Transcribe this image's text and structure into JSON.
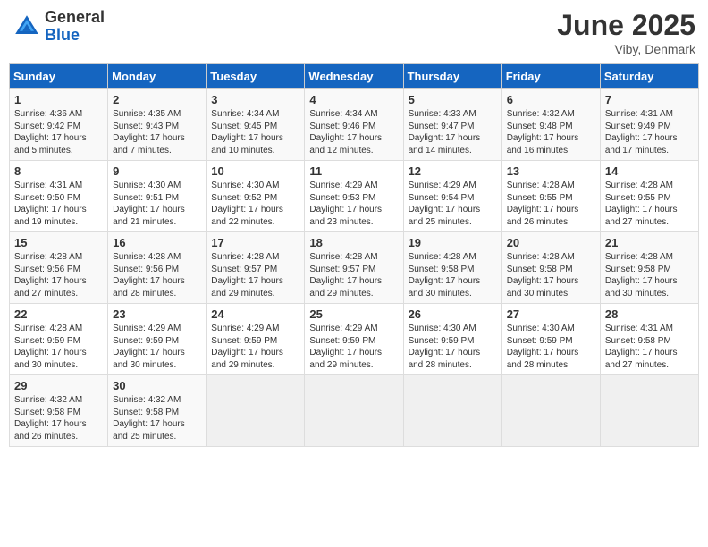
{
  "header": {
    "logo_general": "General",
    "logo_blue": "Blue",
    "month_title": "June 2025",
    "location": "Viby, Denmark"
  },
  "weekdays": [
    "Sunday",
    "Monday",
    "Tuesday",
    "Wednesday",
    "Thursday",
    "Friday",
    "Saturday"
  ],
  "weeks": [
    [
      {
        "day": 1,
        "lines": [
          "Sunrise: 4:36 AM",
          "Sunset: 9:42 PM",
          "Daylight: 17 hours",
          "and 5 minutes."
        ]
      },
      {
        "day": 2,
        "lines": [
          "Sunrise: 4:35 AM",
          "Sunset: 9:43 PM",
          "Daylight: 17 hours",
          "and 7 minutes."
        ]
      },
      {
        "day": 3,
        "lines": [
          "Sunrise: 4:34 AM",
          "Sunset: 9:45 PM",
          "Daylight: 17 hours",
          "and 10 minutes."
        ]
      },
      {
        "day": 4,
        "lines": [
          "Sunrise: 4:34 AM",
          "Sunset: 9:46 PM",
          "Daylight: 17 hours",
          "and 12 minutes."
        ]
      },
      {
        "day": 5,
        "lines": [
          "Sunrise: 4:33 AM",
          "Sunset: 9:47 PM",
          "Daylight: 17 hours",
          "and 14 minutes."
        ]
      },
      {
        "day": 6,
        "lines": [
          "Sunrise: 4:32 AM",
          "Sunset: 9:48 PM",
          "Daylight: 17 hours",
          "and 16 minutes."
        ]
      },
      {
        "day": 7,
        "lines": [
          "Sunrise: 4:31 AM",
          "Sunset: 9:49 PM",
          "Daylight: 17 hours",
          "and 17 minutes."
        ]
      }
    ],
    [
      {
        "day": 8,
        "lines": [
          "Sunrise: 4:31 AM",
          "Sunset: 9:50 PM",
          "Daylight: 17 hours",
          "and 19 minutes."
        ]
      },
      {
        "day": 9,
        "lines": [
          "Sunrise: 4:30 AM",
          "Sunset: 9:51 PM",
          "Daylight: 17 hours",
          "and 21 minutes."
        ]
      },
      {
        "day": 10,
        "lines": [
          "Sunrise: 4:30 AM",
          "Sunset: 9:52 PM",
          "Daylight: 17 hours",
          "and 22 minutes."
        ]
      },
      {
        "day": 11,
        "lines": [
          "Sunrise: 4:29 AM",
          "Sunset: 9:53 PM",
          "Daylight: 17 hours",
          "and 23 minutes."
        ]
      },
      {
        "day": 12,
        "lines": [
          "Sunrise: 4:29 AM",
          "Sunset: 9:54 PM",
          "Daylight: 17 hours",
          "and 25 minutes."
        ]
      },
      {
        "day": 13,
        "lines": [
          "Sunrise: 4:28 AM",
          "Sunset: 9:55 PM",
          "Daylight: 17 hours",
          "and 26 minutes."
        ]
      },
      {
        "day": 14,
        "lines": [
          "Sunrise: 4:28 AM",
          "Sunset: 9:55 PM",
          "Daylight: 17 hours",
          "and 27 minutes."
        ]
      }
    ],
    [
      {
        "day": 15,
        "lines": [
          "Sunrise: 4:28 AM",
          "Sunset: 9:56 PM",
          "Daylight: 17 hours",
          "and 27 minutes."
        ]
      },
      {
        "day": 16,
        "lines": [
          "Sunrise: 4:28 AM",
          "Sunset: 9:56 PM",
          "Daylight: 17 hours",
          "and 28 minutes."
        ]
      },
      {
        "day": 17,
        "lines": [
          "Sunrise: 4:28 AM",
          "Sunset: 9:57 PM",
          "Daylight: 17 hours",
          "and 29 minutes."
        ]
      },
      {
        "day": 18,
        "lines": [
          "Sunrise: 4:28 AM",
          "Sunset: 9:57 PM",
          "Daylight: 17 hours",
          "and 29 minutes."
        ]
      },
      {
        "day": 19,
        "lines": [
          "Sunrise: 4:28 AM",
          "Sunset: 9:58 PM",
          "Daylight: 17 hours",
          "and 30 minutes."
        ]
      },
      {
        "day": 20,
        "lines": [
          "Sunrise: 4:28 AM",
          "Sunset: 9:58 PM",
          "Daylight: 17 hours",
          "and 30 minutes."
        ]
      },
      {
        "day": 21,
        "lines": [
          "Sunrise: 4:28 AM",
          "Sunset: 9:58 PM",
          "Daylight: 17 hours",
          "and 30 minutes."
        ]
      }
    ],
    [
      {
        "day": 22,
        "lines": [
          "Sunrise: 4:28 AM",
          "Sunset: 9:59 PM",
          "Daylight: 17 hours",
          "and 30 minutes."
        ]
      },
      {
        "day": 23,
        "lines": [
          "Sunrise: 4:29 AM",
          "Sunset: 9:59 PM",
          "Daylight: 17 hours",
          "and 30 minutes."
        ]
      },
      {
        "day": 24,
        "lines": [
          "Sunrise: 4:29 AM",
          "Sunset: 9:59 PM",
          "Daylight: 17 hours",
          "and 29 minutes."
        ]
      },
      {
        "day": 25,
        "lines": [
          "Sunrise: 4:29 AM",
          "Sunset: 9:59 PM",
          "Daylight: 17 hours",
          "and 29 minutes."
        ]
      },
      {
        "day": 26,
        "lines": [
          "Sunrise: 4:30 AM",
          "Sunset: 9:59 PM",
          "Daylight: 17 hours",
          "and 28 minutes."
        ]
      },
      {
        "day": 27,
        "lines": [
          "Sunrise: 4:30 AM",
          "Sunset: 9:59 PM",
          "Daylight: 17 hours",
          "and 28 minutes."
        ]
      },
      {
        "day": 28,
        "lines": [
          "Sunrise: 4:31 AM",
          "Sunset: 9:58 PM",
          "Daylight: 17 hours",
          "and 27 minutes."
        ]
      }
    ],
    [
      {
        "day": 29,
        "lines": [
          "Sunrise: 4:32 AM",
          "Sunset: 9:58 PM",
          "Daylight: 17 hours",
          "and 26 minutes."
        ]
      },
      {
        "day": 30,
        "lines": [
          "Sunrise: 4:32 AM",
          "Sunset: 9:58 PM",
          "Daylight: 17 hours",
          "and 25 minutes."
        ]
      },
      null,
      null,
      null,
      null,
      null
    ]
  ]
}
